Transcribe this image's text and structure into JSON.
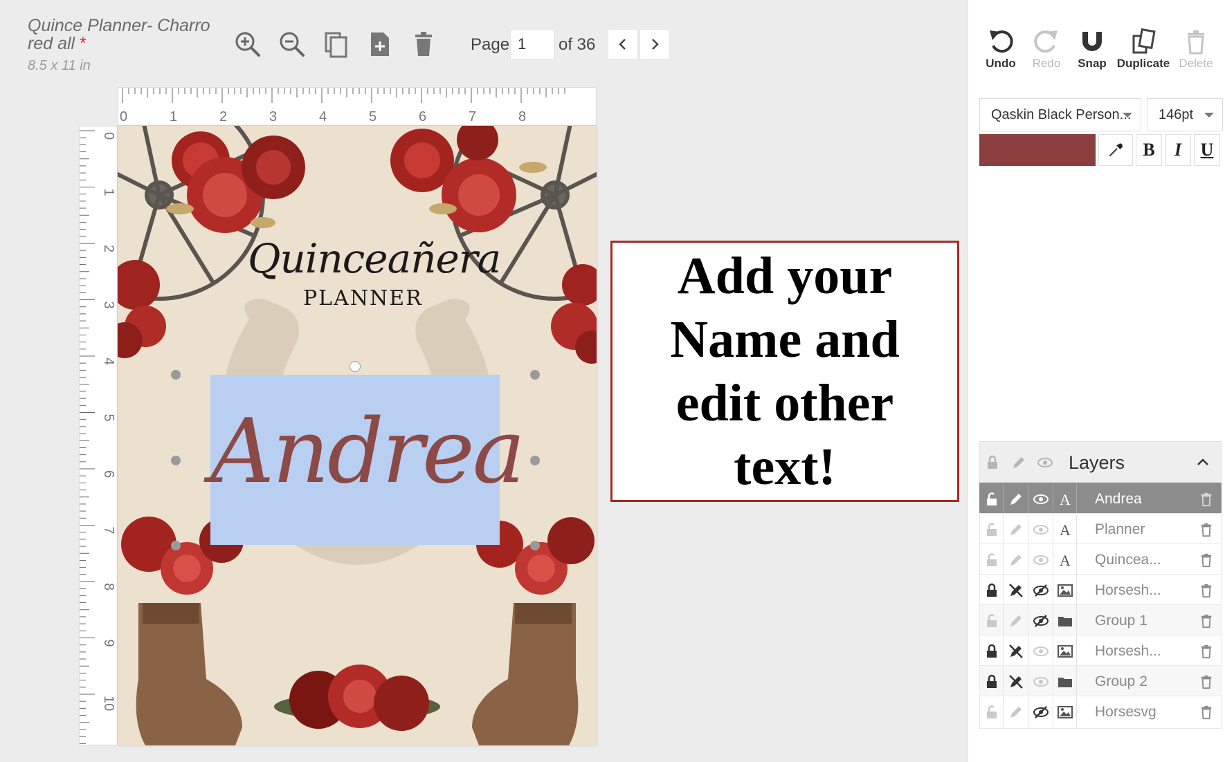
{
  "document": {
    "title": "Quince Planner- Charro red all",
    "unsaved_marker": "*",
    "size": "8.5 x 11 in"
  },
  "toolbar": {
    "icons": [
      "zoom-in-icon",
      "zoom-out-icon",
      "copy-page-icon",
      "add-page-icon",
      "delete-page-icon"
    ],
    "page_label": "Page",
    "page_value": "1",
    "page_of": "of 36"
  },
  "ruler": {
    "horizontal_ticks": [
      "0",
      "1",
      "2",
      "3",
      "4",
      "5",
      "6",
      "7",
      "8"
    ],
    "vertical_ticks": [
      "0",
      "1",
      "2",
      "3",
      "4",
      "5",
      "6",
      "7",
      "8",
      "9",
      "10"
    ]
  },
  "canvas": {
    "title": "Quinceañera",
    "subtitle": "Planner",
    "name_text": "Andrea"
  },
  "callout": {
    "text": "Add your Name and edit other text!"
  },
  "right_panel": {
    "tools": [
      {
        "label": "Undo",
        "icon": "undo-icon",
        "enabled": true
      },
      {
        "label": "Redo",
        "icon": "redo-icon",
        "enabled": false
      },
      {
        "label": "Snap",
        "icon": "magnet-icon",
        "enabled": true
      },
      {
        "label": "Duplicate",
        "icon": "duplicate-icon",
        "enabled": true
      },
      {
        "label": "Delete",
        "icon": "trash-icon",
        "enabled": false
      }
    ],
    "font_family": "Qaskin Black Person...",
    "font_size": "146pt",
    "text_color": "#8b3f3f",
    "style_buttons": [
      "B",
      "I",
      "U"
    ],
    "layers": {
      "title": "Layers",
      "items": [
        {
          "name": "Andrea",
          "type": "text",
          "active": true
        },
        {
          "name": "Planner",
          "type": "text",
          "active": false
        },
        {
          "name": "Quincea...",
          "type": "text",
          "active": false
        },
        {
          "name": "Horsesh...",
          "type": "image",
          "active": false
        },
        {
          "name": "Group 1",
          "type": "folder",
          "active": false
        },
        {
          "name": "Horsesh...",
          "type": "image",
          "active": false
        },
        {
          "name": "Group 2",
          "type": "folder",
          "active": false
        },
        {
          "name": "Horsesvg",
          "type": "image",
          "active": false
        }
      ]
    }
  }
}
